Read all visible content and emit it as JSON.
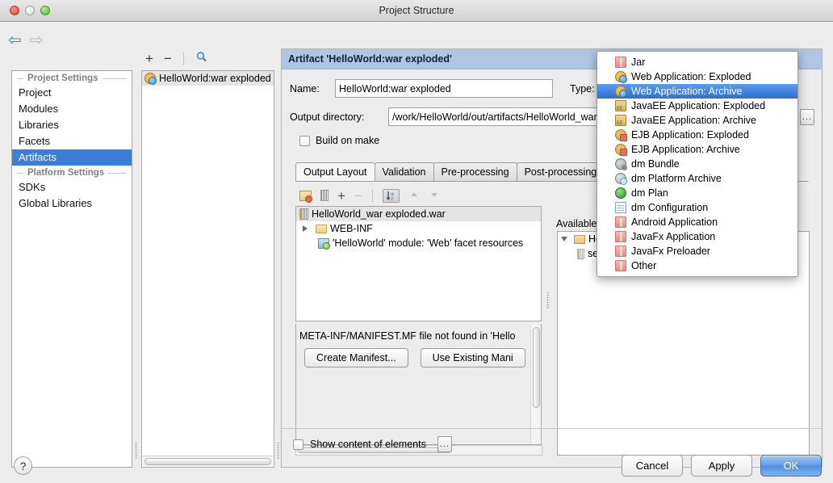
{
  "window": {
    "title": "Project Structure"
  },
  "nav_toolbar": {
    "back_icon": "back-arrow-icon",
    "forward_icon": "forward-arrow-icon"
  },
  "sidebar": {
    "groups": [
      {
        "title": "Project Settings",
        "items": [
          {
            "label": "Project",
            "selected": false
          },
          {
            "label": "Modules",
            "selected": false
          },
          {
            "label": "Libraries",
            "selected": false
          },
          {
            "label": "Facets",
            "selected": false
          },
          {
            "label": "Artifacts",
            "selected": true
          }
        ]
      },
      {
        "title": "Platform Settings",
        "items": [
          {
            "label": "SDKs",
            "selected": false
          },
          {
            "label": "Global Libraries",
            "selected": false
          }
        ]
      }
    ]
  },
  "artifacts_panel": {
    "toolbar": {
      "add": "+",
      "remove": "−",
      "find": "search-icon"
    },
    "items": [
      {
        "label": "HelloWorld:war exploded",
        "selected": true
      }
    ]
  },
  "details": {
    "header": "Artifact 'HelloWorld:war exploded'",
    "name_label": "Name:",
    "name_value": "HelloWorld:war exploded",
    "type_label": "Type:",
    "output_dir_label": "Output directory:",
    "output_dir_value": "/work/HelloWorld/out/artifacts/HelloWorld_war_exploded",
    "browse_button": "...",
    "build_on_make_label": "Build on make",
    "build_on_make_checked": false,
    "tabs": [
      {
        "label": "Output Layout",
        "active": true
      },
      {
        "label": "Validation",
        "active": false
      },
      {
        "label": "Pre-processing",
        "active": false
      },
      {
        "label": "Post-processing",
        "active": false
      }
    ],
    "layout_toolbar": {
      "create_directory": "new-directory-icon",
      "create_archive": "new-archive-icon",
      "add": "+",
      "remove": "−",
      "sort": "sort-az-icon",
      "move_up": "move-up-icon",
      "move_down": "move-down-icon"
    },
    "output_tree": [
      {
        "label": "HelloWorld_war exploded.war",
        "icon": "war-file-icon",
        "level": 0,
        "expander": "none",
        "header": true
      },
      {
        "label": "WEB-INF",
        "icon": "folder-icon",
        "level": 1,
        "expander": "collapsed",
        "header": false
      },
      {
        "label": "'HelloWorld' module: 'Web' facet resources",
        "icon": "module-icon",
        "level": 2,
        "expander": "none",
        "header": false
      }
    ],
    "manifest_message": "META-INF/MANIFEST.MF file not found in 'Hello",
    "create_manifest_button": "Create Manifest...",
    "use_existing_manifest_button": "Use Existing Mani",
    "available_elements_label": "Available Elements",
    "available_tree": [
      {
        "label": "HelloWorld",
        "icon": "folder-module-icon",
        "expander": "expanded"
      },
      {
        "label": "server_api.jar",
        "icon": "jar-file-icon",
        "expander": "none"
      }
    ],
    "show_content_label": "Show content of elements",
    "show_content_checked": false,
    "show_content_browse": "..."
  },
  "type_dropdown": {
    "items": [
      {
        "label": "Jar",
        "icon": "gift-icon",
        "selected": false
      },
      {
        "label": "Web Application: Exploded",
        "icon": "web-app-icon",
        "selected": false
      },
      {
        "label": "Web Application: Archive",
        "icon": "web-app-icon",
        "selected": true
      },
      {
        "label": "JavaEE Application: Exploded",
        "icon": "javaee-app-icon",
        "selected": false
      },
      {
        "label": "JavaEE Application: Archive",
        "icon": "javaee-app-icon",
        "selected": false
      },
      {
        "label": "EJB Application: Exploded",
        "icon": "ejb-app-icon",
        "selected": false
      },
      {
        "label": "EJB Application: Archive",
        "icon": "ejb-app-icon",
        "selected": false
      },
      {
        "label": "dm Bundle",
        "icon": "dm-bundle-icon",
        "selected": false
      },
      {
        "label": "dm Platform Archive",
        "icon": "dm-platform-icon",
        "selected": false
      },
      {
        "label": "dm Plan",
        "icon": "dm-plan-icon",
        "selected": false
      },
      {
        "label": "dm Configuration",
        "icon": "document-icon",
        "selected": false
      },
      {
        "label": "Android Application",
        "icon": "gift-icon",
        "selected": false
      },
      {
        "label": "JavaFx Application",
        "icon": "gift-icon",
        "selected": false
      },
      {
        "label": "JavaFx Preloader",
        "icon": "gift-icon",
        "selected": false
      },
      {
        "label": "Other",
        "icon": "gift-icon",
        "selected": false
      }
    ]
  },
  "footer": {
    "help": "?",
    "buttons": [
      {
        "label": "Cancel",
        "default": false
      },
      {
        "label": "Apply",
        "default": false
      },
      {
        "label": "OK",
        "default": true
      }
    ]
  },
  "colors": {
    "selection_blue": "#3b7dd8",
    "header_blue": "#aec5e3",
    "dropdown_selection": "#2a6fd8",
    "window_bg": "#ececec"
  }
}
